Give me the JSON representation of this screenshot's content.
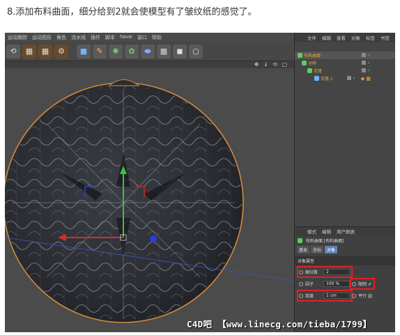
{
  "caption": "8.添加布料曲面，细分给到2就会使模型有了皱纹纸的感觉了。",
  "menubar": [
    "运动跟踪",
    "运动图形",
    "角色",
    "流水线",
    "插件",
    "脚本",
    "Navie",
    "窗口",
    "帮助"
  ],
  "toolbar": {
    "icons": [
      "undo-icon",
      "film-icon",
      "film-icon",
      "film-gear-icon",
      "cube-icon",
      "pen-icon",
      "gear-green-icon",
      "flower-icon",
      "capsule-icon",
      "grid-icon",
      "camera-icon",
      "bulb-icon"
    ]
  },
  "object_manager": {
    "menu": [
      "文件",
      "编辑",
      "查看",
      "对象",
      "标签",
      "书签"
    ],
    "rows": [
      {
        "name": "布料曲面",
        "selected": true
      },
      {
        "name": "对称",
        "selected": false
      },
      {
        "name": "克隆",
        "selected": false
      },
      {
        "name": "克隆.1",
        "selected": false
      }
    ]
  },
  "attributes": {
    "menu": [
      "模式",
      "编辑",
      "用户数据"
    ],
    "title": "布料曲面 [布料曲面]",
    "tabs": [
      "基本",
      "坐标",
      "对象"
    ],
    "active_tab": "对象",
    "section": "对象属性",
    "subdivisions_label": "细分数",
    "subdivisions_value": "2",
    "factor_label": "因子",
    "factor_value": "100 %",
    "limit_label": "限制",
    "limit_check": "✓",
    "thickness_label": "厚度",
    "thickness_value": "1 cm",
    "parallel_label": "平行"
  },
  "watermark": "C4D吧 【www.linecg.com/tieba/1799】",
  "colors": {
    "highlight": "#e0202a",
    "object_orange": "#e8a23a",
    "active_tab": "#5e82b5"
  }
}
